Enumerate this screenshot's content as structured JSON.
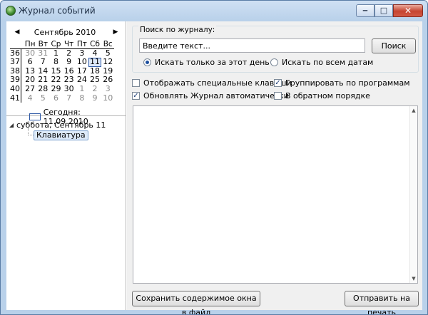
{
  "window": {
    "title": "Журнал событий",
    "minimize_glyph": "‒",
    "maximize_glyph": "□",
    "close_glyph": "✕"
  },
  "calendar": {
    "month_title": "Сентябрь 2010",
    "prev_glyph": "◀",
    "next_glyph": "▶",
    "weekday_headers": [
      "Пн",
      "Вт",
      "Ср",
      "Чт",
      "Пт",
      "Сб",
      "Вс"
    ],
    "weeks": [
      {
        "num": "36",
        "days": [
          {
            "d": "30",
            "other": true
          },
          {
            "d": "31",
            "other": true
          },
          {
            "d": "1"
          },
          {
            "d": "2"
          },
          {
            "d": "3"
          },
          {
            "d": "4"
          },
          {
            "d": "5"
          }
        ]
      },
      {
        "num": "37",
        "days": [
          {
            "d": "6"
          },
          {
            "d": "7"
          },
          {
            "d": "8"
          },
          {
            "d": "9"
          },
          {
            "d": "10"
          },
          {
            "d": "11",
            "selected": true
          },
          {
            "d": "12"
          }
        ]
      },
      {
        "num": "38",
        "days": [
          {
            "d": "13"
          },
          {
            "d": "14"
          },
          {
            "d": "15"
          },
          {
            "d": "16"
          },
          {
            "d": "17"
          },
          {
            "d": "18"
          },
          {
            "d": "19"
          }
        ]
      },
      {
        "num": "39",
        "days": [
          {
            "d": "20"
          },
          {
            "d": "21"
          },
          {
            "d": "22"
          },
          {
            "d": "23"
          },
          {
            "d": "24"
          },
          {
            "d": "25"
          },
          {
            "d": "26"
          }
        ]
      },
      {
        "num": "40",
        "days": [
          {
            "d": "27"
          },
          {
            "d": "28"
          },
          {
            "d": "29"
          },
          {
            "d": "30"
          },
          {
            "d": "1",
            "other": true
          },
          {
            "d": "2",
            "other": true
          },
          {
            "d": "3",
            "other": true
          }
        ]
      },
      {
        "num": "41",
        "days": [
          {
            "d": "4",
            "other": true
          },
          {
            "d": "5",
            "other": true
          },
          {
            "d": "6",
            "other": true
          },
          {
            "d": "7",
            "other": true
          },
          {
            "d": "8",
            "other": true
          },
          {
            "d": "9",
            "other": true
          },
          {
            "d": "10",
            "other": true
          }
        ]
      }
    ],
    "today_label": "Сегодня: 11.09.2010"
  },
  "tree": {
    "expander_glyph": "◢",
    "root_label": "суббота, Сентябрь 11",
    "child_label": "Клавиатура"
  },
  "search": {
    "group_title": "Поиск по журналу:",
    "input_value": "Введите текст...",
    "button_label": "Поиск",
    "radio_this_day": "Искать только за этот день",
    "radio_all_dates": "Искать по всем датам",
    "selected_radio": "this_day"
  },
  "options": {
    "show_special_keys": {
      "label": "Отображать специальные клавиши",
      "checked": false
    },
    "group_by_programs": {
      "label": "Группировать по программам",
      "checked": true
    },
    "auto_refresh": {
      "label": "Обновлять Журнал автоматически",
      "checked": true
    },
    "reverse_order": {
      "label": "В обратном порядке",
      "checked": false
    },
    "check_glyph": "✓"
  },
  "log": {
    "scroll_up_glyph": "▲",
    "scroll_down_glyph": "▼"
  },
  "footer": {
    "save_label": "Сохранить содержимое окна в файл",
    "print_label": "Отправить на печать"
  }
}
